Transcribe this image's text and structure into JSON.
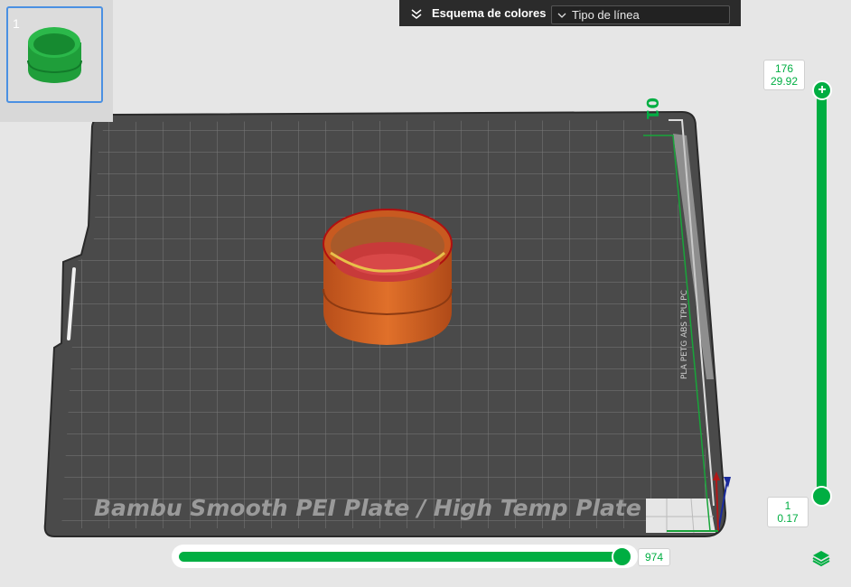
{
  "plate_list": {
    "thumbnails": [
      {
        "number": "1"
      }
    ]
  },
  "color_scheme": {
    "label": "Esquema de colores",
    "selected": "Tipo de línea"
  },
  "plate": {
    "name": "Bambu Smooth PEI Plate / High Temp Plate",
    "number": "01",
    "side_label": "PLA PETG ABS TPU PC"
  },
  "layer_slider": {
    "top": {
      "layer": "176",
      "height": "29.92"
    },
    "bottom": {
      "layer": "1",
      "height": "0.17"
    }
  },
  "move_slider": {
    "value": "974"
  },
  "colors": {
    "accent": "#00ae42",
    "plate": "#464646",
    "model": "#d4601f"
  },
  "icons": [
    "chevron-down-icon",
    "layers-icon",
    "plus-icon"
  ]
}
